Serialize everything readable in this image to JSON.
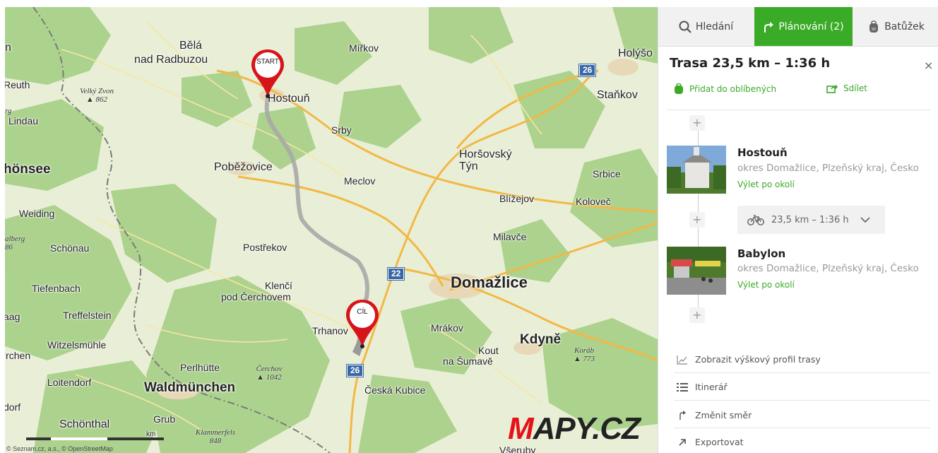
{
  "map": {
    "places": [
      {
        "id": "n",
        "text": "n",
        "size": "m"
      },
      {
        "id": "bela",
        "text": "Bělá",
        "size": "m"
      },
      {
        "id": "nadradbuzou",
        "text": "nad Radbuzou",
        "size": "m"
      },
      {
        "id": "mirkov",
        "text": "Mířkov",
        "size": "s"
      },
      {
        "id": "holysov",
        "text": "Holýšo",
        "size": "m"
      },
      {
        "id": "reuth",
        "text": "Reuth",
        "size": "s"
      },
      {
        "id": "hostoun",
        "text": "Hostouň",
        "size": "m"
      },
      {
        "id": "stankov",
        "text": "Staňkov",
        "size": "m"
      },
      {
        "id": "lindau",
        "text": "Lindau",
        "size": "s"
      },
      {
        "id": "srby",
        "text": "Srby",
        "size": "s"
      },
      {
        "id": "horsovsky",
        "text": "Horšovský",
        "size": "m"
      },
      {
        "id": "tyn",
        "text": "Týn",
        "size": "m"
      },
      {
        "id": "honsee",
        "text": "hönsee",
        "size": "l"
      },
      {
        "id": "pobezovice",
        "text": "Poběžovice",
        "size": "m"
      },
      {
        "id": "meclov",
        "text": "Meclov",
        "size": "s"
      },
      {
        "id": "srbice",
        "text": "Srbice",
        "size": "s"
      },
      {
        "id": "blizejov",
        "text": "Blížejov",
        "size": "s"
      },
      {
        "id": "kolovec",
        "text": "Koloveč",
        "size": "s"
      },
      {
        "id": "weiding",
        "text": "Weiding",
        "size": "s"
      },
      {
        "id": "milavce",
        "text": "Milavče",
        "size": "s"
      },
      {
        "id": "schonau",
        "text": "Schönau",
        "size": "s"
      },
      {
        "id": "postrekov",
        "text": "Postřekov",
        "size": "s"
      },
      {
        "id": "domazlice",
        "text": "Domažlice",
        "size": "xl"
      },
      {
        "id": "tiefenbach",
        "text": "Tiefenbach",
        "size": "s"
      },
      {
        "id": "klenci",
        "text": "Klenčí",
        "size": "s"
      },
      {
        "id": "podcerchovem",
        "text": "pod Čerchovem",
        "size": "s"
      },
      {
        "id": "aag",
        "text": "aag",
        "size": "s"
      },
      {
        "id": "treffelstein",
        "text": "Treffelstein",
        "size": "s"
      },
      {
        "id": "trhanov",
        "text": "Trhanov",
        "size": "s"
      },
      {
        "id": "mrakov",
        "text": "Mrákov",
        "size": "s"
      },
      {
        "id": "kdyne",
        "text": "Kdyně",
        "size": "l"
      },
      {
        "id": "witzelsmuhle",
        "text": "Witzelsmühle",
        "size": "s"
      },
      {
        "id": "kout",
        "text": "Kout",
        "size": "s"
      },
      {
        "id": "nasumave",
        "text": "na Šumavě",
        "size": "s"
      },
      {
        "id": "irchen",
        "text": "irchen",
        "size": "s"
      },
      {
        "id": "perlhutte",
        "text": "Perlhütte",
        "size": "s"
      },
      {
        "id": "loitendorf",
        "text": "Loitendorf",
        "size": "s"
      },
      {
        "id": "waldmunchen",
        "text": "Waldmünchen",
        "size": "l"
      },
      {
        "id": "ceskakubice",
        "text": "Česká Kubice",
        "size": "s"
      },
      {
        "id": "dorf",
        "text": "dorf",
        "size": "s"
      },
      {
        "id": "grub",
        "text": "Grub",
        "size": "s"
      },
      {
        "id": "schonthal",
        "text": "Schönthal",
        "size": "m"
      },
      {
        "id": "vseruby",
        "text": "Všeruby",
        "size": "s"
      }
    ],
    "peaks": [
      {
        "id": "velkyzvon",
        "text": "Velký Zvon ▲ 862"
      },
      {
        "id": "rg",
        "text": "rg"
      },
      {
        "id": "alberg",
        "text": "alberg 86"
      },
      {
        "id": "korab",
        "text": "Koráb ▲ 773"
      },
      {
        "id": "cerchov",
        "text": "Čerchov ▲ 1042"
      },
      {
        "id": "klammerfels",
        "text": "Klammerfels 848"
      }
    ],
    "road_shields": [
      "26",
      "22",
      "26"
    ],
    "markers": {
      "start": "START",
      "end": "CÍL"
    },
    "logo": {
      "first": "M",
      "rest": "APY.CZ"
    },
    "scale_unit": "km",
    "attribution": "© Seznam.cz, a.s., © OpenStreetMap",
    "colors": {
      "route": "#a8a8a8",
      "marker": "#d7141a",
      "forest": "#a8cf85",
      "field": "#ecf1d8",
      "road": "#f3c052",
      "border": "#777777"
    }
  },
  "panel": {
    "tabs": [
      {
        "label": "Hledání",
        "icon": "search-icon",
        "active": false
      },
      {
        "label": "Plánování (2)",
        "icon": "route-icon",
        "active": true
      },
      {
        "label": "Batůžek",
        "icon": "backpack-icon",
        "active": false
      }
    ],
    "title": "Trasa 23,5 km – 1:36 h",
    "close": "×",
    "actions": {
      "favorite": "Přidat do oblíbených",
      "share": "Sdílet"
    },
    "waypoints": [
      {
        "name": "Hostouň",
        "subtitle": "okres Domažlice, Plzeňský kraj, Česko",
        "link": "Výlet po okolí"
      },
      {
        "name": "Babylon",
        "subtitle": "okres Domažlice, Plzeňský kraj, Česko",
        "link": "Výlet po okolí"
      }
    ],
    "leg": {
      "mode_icon": "bicycle-icon",
      "summary": "23,5 km – 1:36 h"
    },
    "plus": "+",
    "menu": [
      {
        "label": "Zobrazit výškový profil trasy",
        "icon": "elevation-icon"
      },
      {
        "label": "Itinerář",
        "icon": "list-icon"
      },
      {
        "label": "Změnit směr",
        "icon": "reverse-icon"
      },
      {
        "label": "Exportovat",
        "icon": "export-icon"
      }
    ]
  }
}
